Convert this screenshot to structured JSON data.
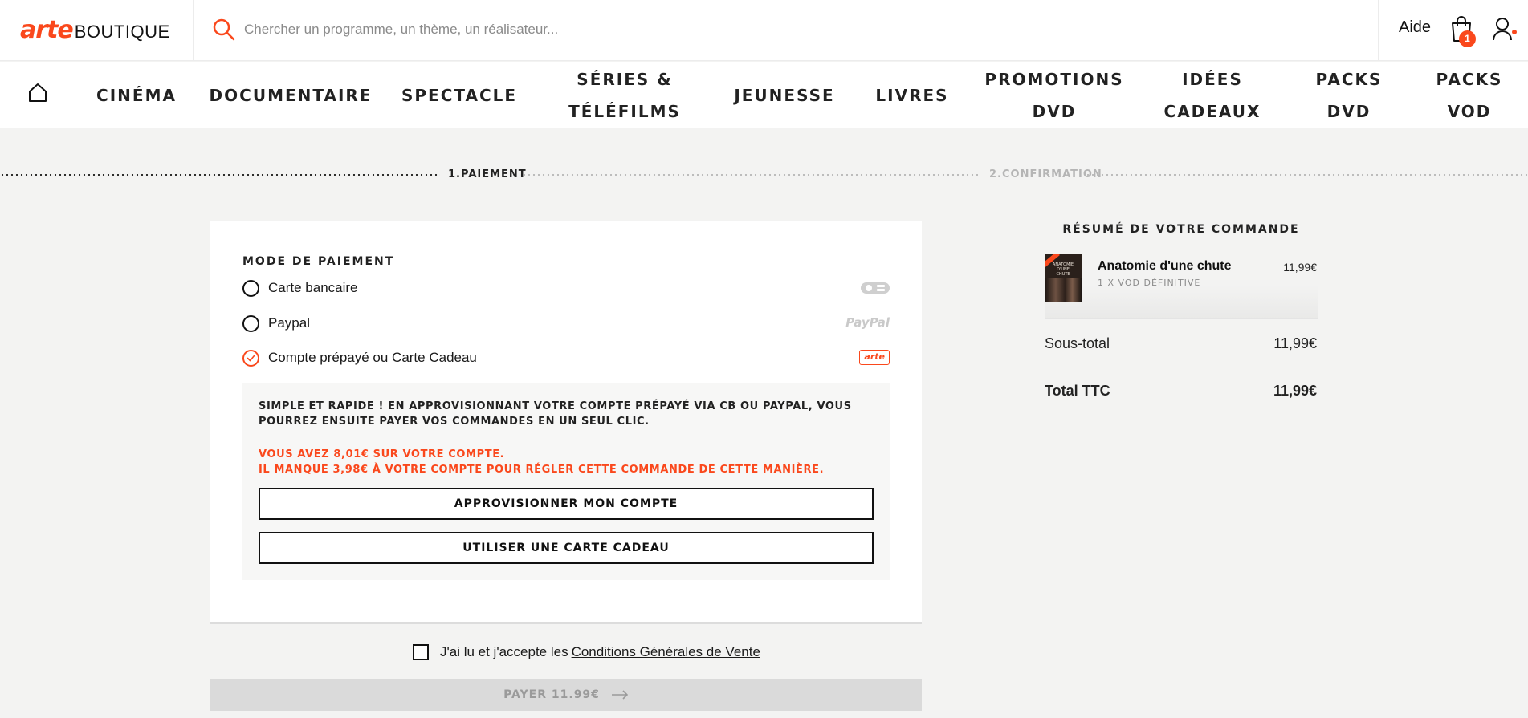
{
  "header": {
    "logo_arte": "arte",
    "logo_boutique": "BOUTIQUE",
    "search_placeholder": "Chercher un programme, un thème, un réalisateur...",
    "help_label": "Aide",
    "cart_count": "1",
    "accent_color": "#fa481c"
  },
  "nav": {
    "items": [
      {
        "label": "CINÉMA"
      },
      {
        "label": "DOCUMENTAIRE"
      },
      {
        "label": "SPECTACLE"
      },
      {
        "label": "SÉRIES &\nTÉLÉFILMS"
      },
      {
        "label": "JEUNESSE"
      },
      {
        "label": "LIVRES"
      },
      {
        "label": "PROMOTIONS\nDVD"
      },
      {
        "label": "IDÉES\nCADEAUX"
      },
      {
        "label": "PACKS\nDVD"
      },
      {
        "label": "PACKS\nVOD"
      }
    ]
  },
  "steps": {
    "step1": "1.PAIEMENT",
    "step2": "2.CONFIRMATION"
  },
  "payment": {
    "title": "MODE DE PAIEMENT",
    "methods": [
      {
        "label": "Carte bancaire",
        "logo": "CB",
        "selected": false
      },
      {
        "label": "Paypal",
        "logo": "PayPal",
        "selected": false
      },
      {
        "label": "Compte prépayé ou Carte Cadeau",
        "logo": "arte",
        "selected": true
      }
    ],
    "prepaid_description": "SIMPLE ET RAPIDE ! EN APPROVISIONNANT VOTRE COMPTE PRÉPAYÉ VIA CB OU PAYPAL, VOUS POURREZ ENSUITE PAYER VOS COMMANDES EN UN SEUL CLIC.",
    "balance_line": "VOUS AVEZ 8,01€ SUR VOTRE COMPTE.",
    "missing_line": "IL MANQUE 3,98€ À VOTRE COMPTE POUR RÉGLER CETTE COMMANDE DE CETTE MANIÈRE.",
    "topup_button": "APPROVISIONNER MON COMPTE",
    "giftcard_button": "UTILISER UNE CARTE CADEAU"
  },
  "terms": {
    "text": "J'ai lu et j'accepte les",
    "link": "Conditions Générales de Vente"
  },
  "pay_button": "PAYER 11.99€",
  "summary": {
    "title": "RÉSUMÉ DE VOTRE COMMANDE",
    "item": {
      "title": "Anatomie d'une chute",
      "subtitle": "1 X VOD DÉFINITIVE",
      "price": "11,99€",
      "thumb_text": "ANATOMIE D'UNE CHUTE"
    },
    "subtotal_label": "Sous-total",
    "subtotal_value": "11,99€",
    "total_label": "Total TTC",
    "total_value": "11,99€"
  }
}
